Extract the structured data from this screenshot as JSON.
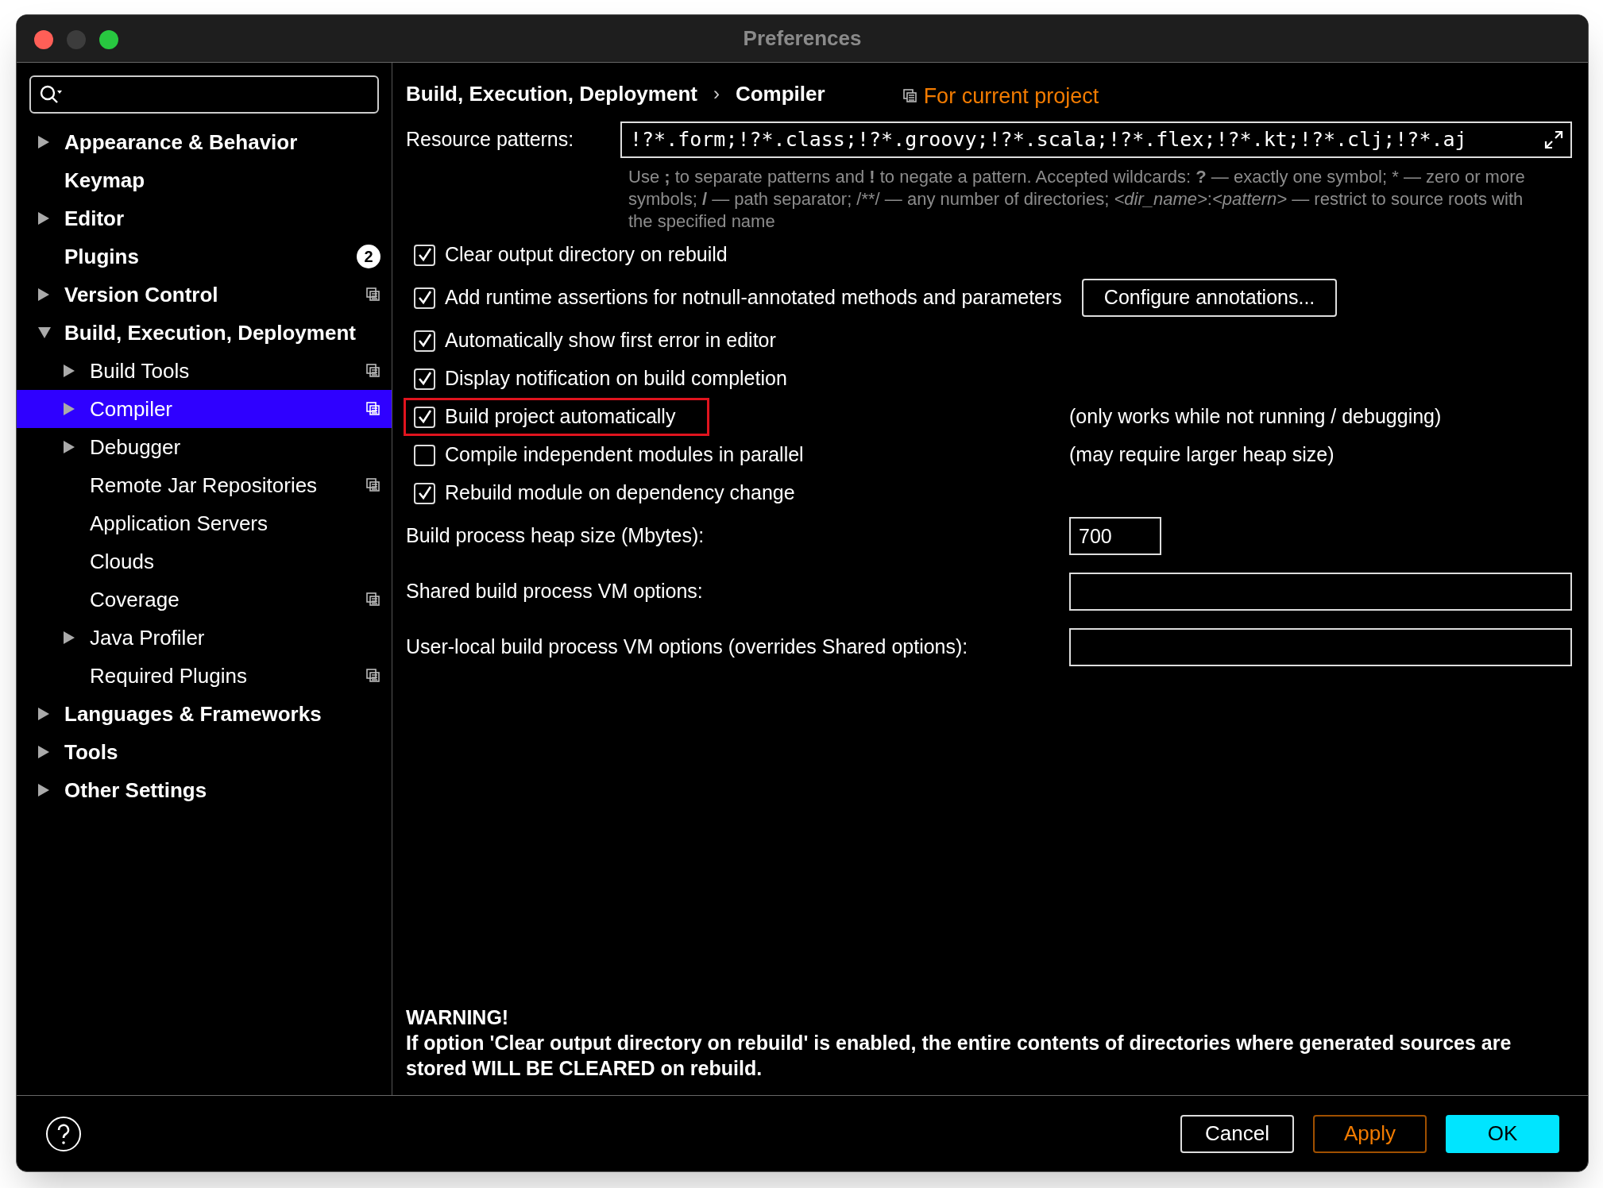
{
  "window": {
    "title": "Preferences"
  },
  "sidebar": {
    "items": [
      {
        "label": "Appearance & Behavior",
        "expanded": false,
        "selected": false
      },
      {
        "label": "Keymap",
        "selected": false
      },
      {
        "label": "Editor",
        "expanded": false,
        "selected": false
      },
      {
        "label": "Plugins",
        "selected": false,
        "badge": "2"
      },
      {
        "label": "Version Control",
        "expanded": false,
        "selected": false,
        "project_level": true
      },
      {
        "label": "Build, Execution, Deployment",
        "expanded": true,
        "selected": false,
        "children": [
          {
            "label": "Build Tools",
            "expanded": false,
            "selected": false,
            "project_level": true
          },
          {
            "label": "Compiler",
            "expanded": false,
            "selected": true,
            "project_level": true
          },
          {
            "label": "Debugger",
            "expanded": false,
            "selected": false
          },
          {
            "label": "Remote Jar Repositories",
            "selected": false,
            "project_level": true
          },
          {
            "label": "Application Servers",
            "selected": false
          },
          {
            "label": "Clouds",
            "selected": false
          },
          {
            "label": "Coverage",
            "selected": false,
            "project_level": true
          },
          {
            "label": "Java Profiler",
            "expanded": false,
            "selected": false
          },
          {
            "label": "Required Plugins",
            "selected": false,
            "project_level": true
          }
        ]
      },
      {
        "label": "Languages & Frameworks",
        "expanded": false,
        "selected": false
      },
      {
        "label": "Tools",
        "expanded": false,
        "selected": false
      },
      {
        "label": "Other Settings",
        "expanded": false,
        "selected": false
      }
    ]
  },
  "breadcrumb": [
    "Build, Execution, Deployment",
    "Compiler"
  ],
  "breadcrumb_separator": "›",
  "scope_label": "For current project",
  "resource_patterns": {
    "label": "Resource patterns:",
    "value": "!?*.form;!?*.class;!?*.groovy;!?*.scala;!?*.flex;!?*.kt;!?*.clj;!?*.aj"
  },
  "hint": "Use **;** to separate patterns and **!** to negate a pattern. Accepted wildcards: **?** — exactly one symbol; * — zero or more symbols; **/** — path separator; /**/ — any number of directories; *<dir_name>*:*<pattern>* — restrict to source roots with the specified name",
  "options": [
    {
      "label": "Clear output directory on rebuild",
      "checked": true
    },
    {
      "label": "Add runtime assertions for notnull-annotated methods and parameters",
      "checked": true,
      "button": "Configure annotations..."
    },
    {
      "label": "Automatically show first error in editor",
      "checked": true
    },
    {
      "label": "Display notification on build completion",
      "checked": true
    },
    {
      "label": "Build project automatically",
      "checked": true,
      "highlighted": true,
      "note": "(only works while not running / debugging)"
    },
    {
      "label": "Compile independent modules in parallel",
      "checked": false,
      "note": "(may require larger heap size)"
    },
    {
      "label": "Rebuild module on dependency change",
      "checked": true
    }
  ],
  "fields": [
    {
      "label": "Build process heap size (Mbytes):",
      "value": "700",
      "kind": "short"
    },
    {
      "label": "Shared build process VM options:",
      "kind": "wide"
    },
    {
      "label": "User-local build process VM options (overrides Shared options):",
      "kind": "wide"
    }
  ],
  "warning": {
    "title": "WARNING!",
    "text": "If option 'Clear output directory on rebuild' is enabled, the entire contents of directories where generated sources are stored WILL BE CLEARED on rebuild."
  },
  "buttons": [
    {
      "label": "Cancel",
      "kind": "default"
    },
    {
      "label": "Apply",
      "kind": "apply"
    },
    {
      "label": "OK",
      "kind": "primary"
    }
  ]
}
